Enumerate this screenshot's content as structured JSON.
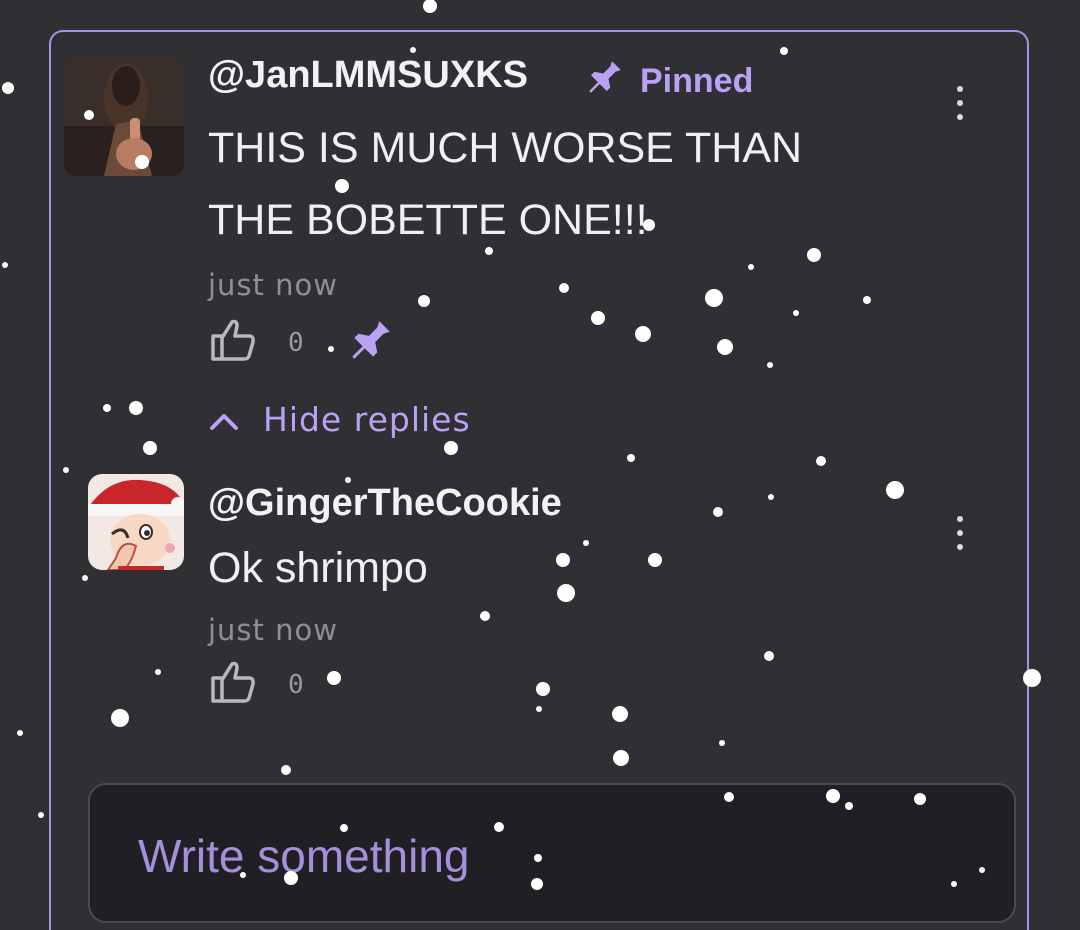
{
  "comment": {
    "username": "@JanLMMSUXKS",
    "pinned_label": "Pinned",
    "text_line1": "THIS IS MUCH WORSE THAN",
    "text_line2": "THE BOBETTE ONE!!!",
    "timestamp": "just now",
    "like_count": "0"
  },
  "replies_toggle": {
    "label": "Hide replies",
    "icon": "chevron-up-icon"
  },
  "reply": {
    "username": "@GingerTheCookie",
    "text": "Ok shrimpo",
    "timestamp": "just now",
    "like_count": "0"
  },
  "composer": {
    "placeholder": "Write something"
  },
  "colors": {
    "background": "#2f2f34",
    "accent": "#b9a2f3",
    "thread_border": "#a992e8",
    "composer_bg": "#202024"
  }
}
